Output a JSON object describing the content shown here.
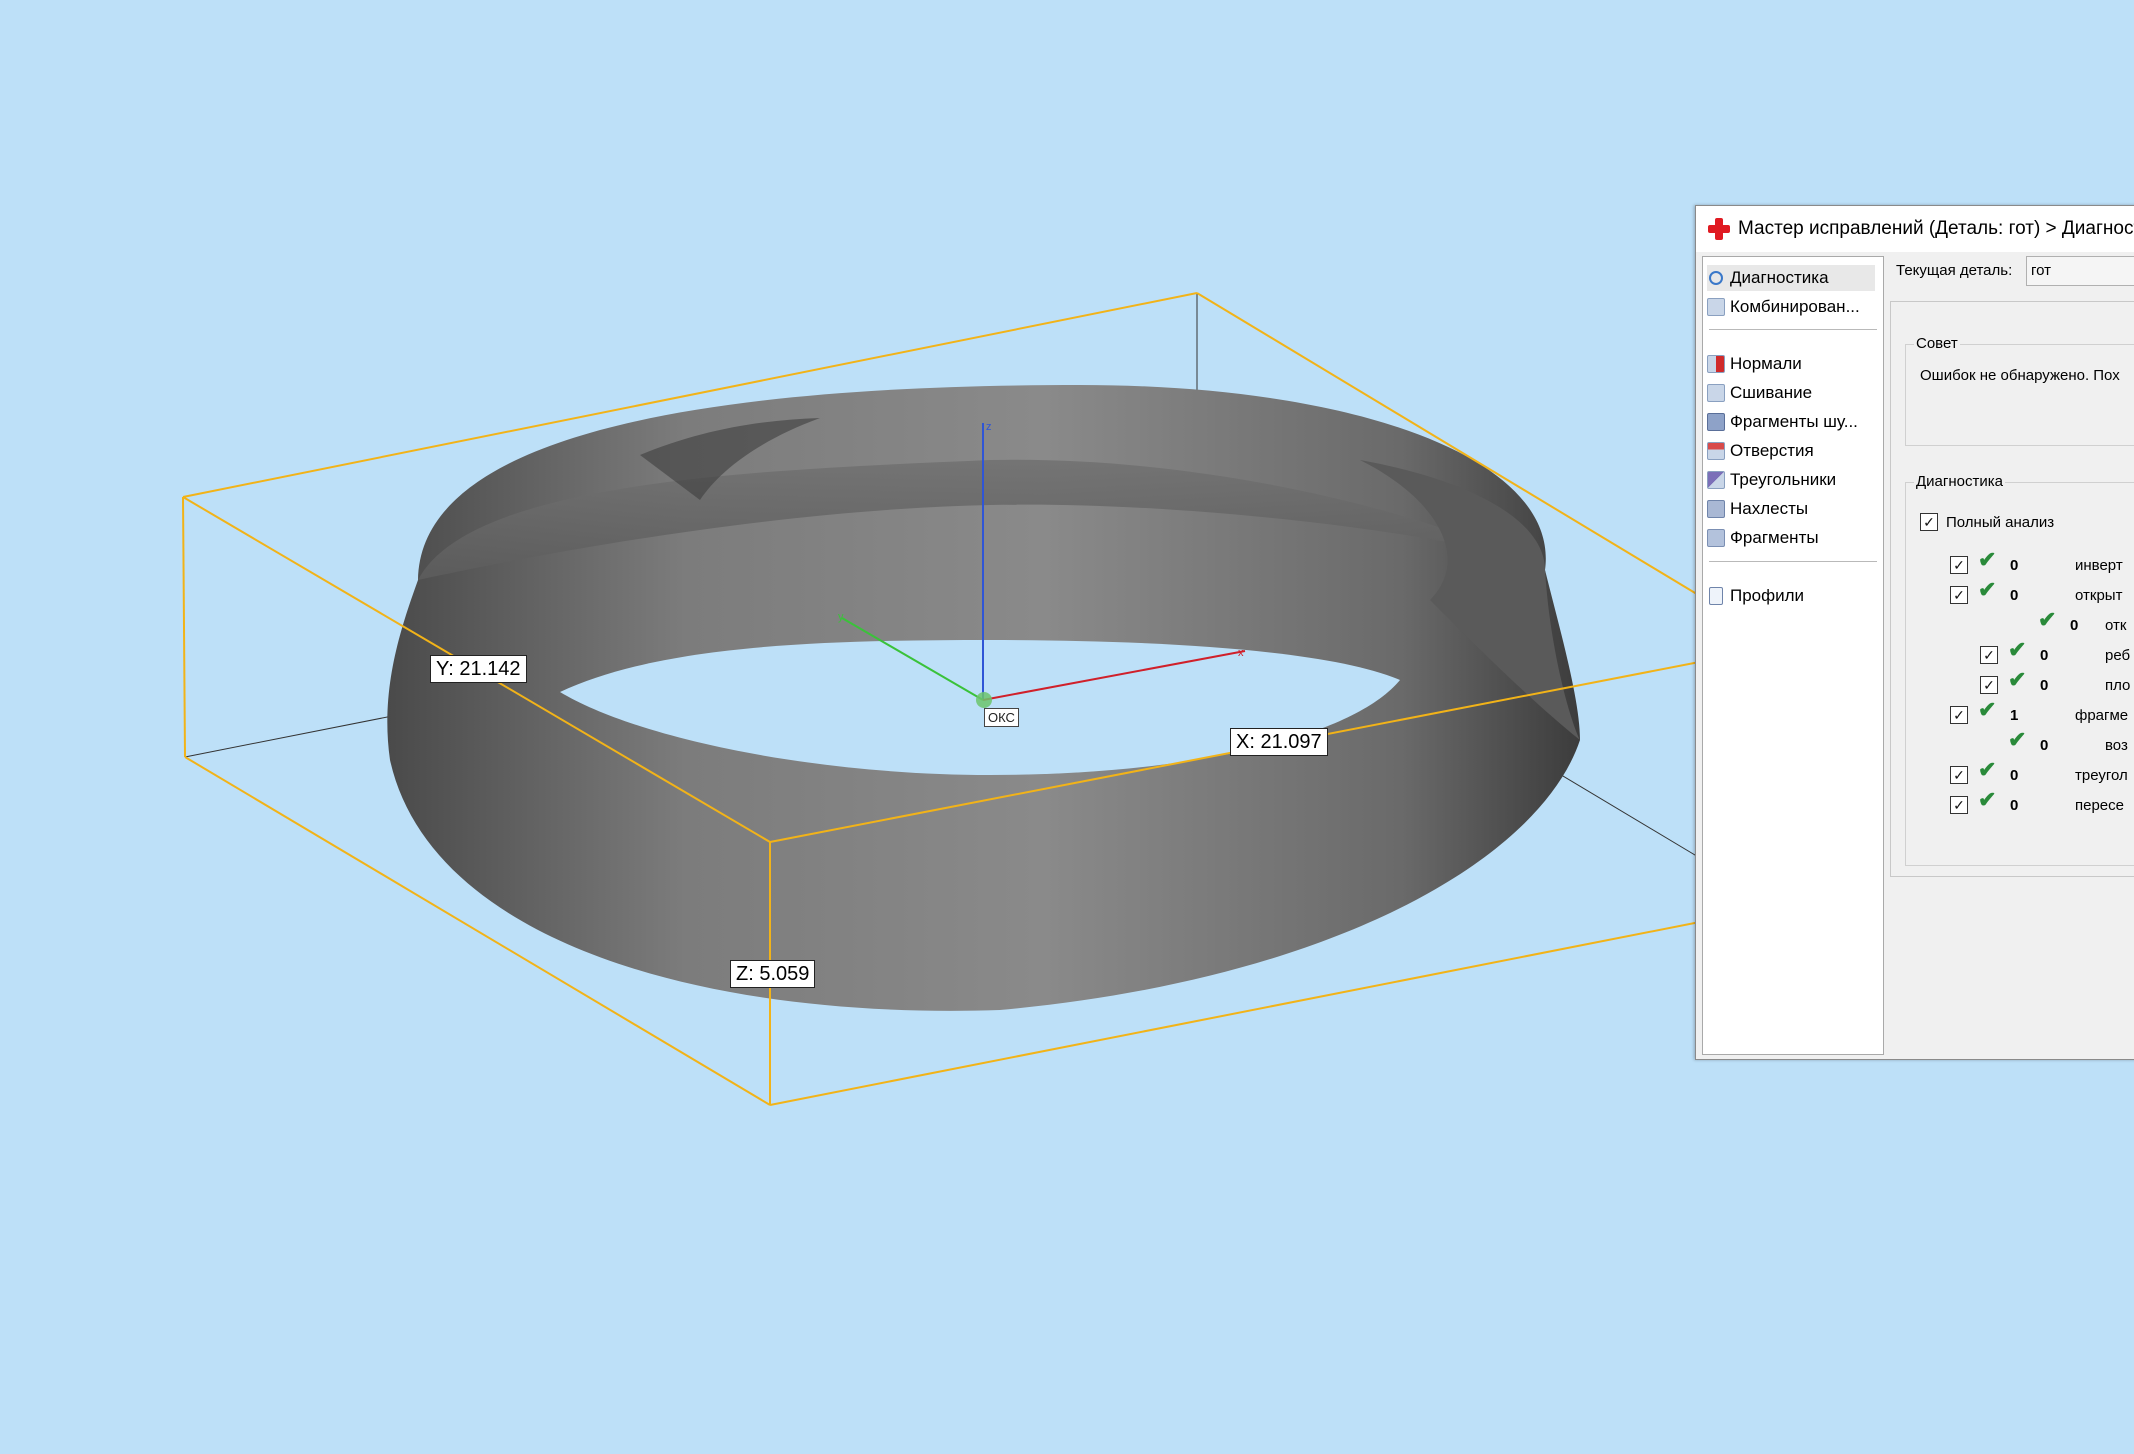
{
  "viewport": {
    "background_color": "#bde0f8",
    "bbox_color": "#f2b318",
    "model_color": "#6b6b6b",
    "dimensions": {
      "x_label": "X: 21.097",
      "y_label": "Y: 21.142",
      "z_label": "Z: 5.059"
    },
    "axes": {
      "origin_label": "ОКС",
      "z_axis_label": "z",
      "y_axis_label": "y",
      "x_axis_label": "x",
      "x_color": "#d0202a",
      "y_color": "#3ac23a",
      "z_color": "#2f55d6"
    }
  },
  "wizard": {
    "title": "Мастер исправлений (Деталь: гот) > Диагностика",
    "nav": {
      "items": [
        {
          "label": "Диагностика",
          "icon": "magnifier-icon"
        },
        {
          "label": "Комбинирован...",
          "icon": "combine-icon"
        },
        {
          "label": "Нормали",
          "icon": "normals-icon"
        },
        {
          "label": "Сшивание",
          "icon": "stitching-icon"
        },
        {
          "label": "Фрагменты шу...",
          "icon": "noise-shells-icon"
        },
        {
          "label": "Отверстия",
          "icon": "holes-icon"
        },
        {
          "label": "Треугольники",
          "icon": "triangles-icon"
        },
        {
          "label": "Нахлесты",
          "icon": "overlaps-icon"
        },
        {
          "label": "Фрагменты",
          "icon": "shells-icon"
        },
        {
          "label": "Профили",
          "icon": "profiles-icon"
        }
      ]
    },
    "current_part_label": "Текущая деталь:",
    "current_part_value": "гот",
    "advice": {
      "title": "Совет",
      "text": "Ошибок не обнаружено. Пох"
    },
    "diagnostics": {
      "title": "Диагностика",
      "full_analysis": "Полный анализ",
      "rows": [
        {
          "count": "0",
          "label": "инверт"
        },
        {
          "count": "0",
          "label": "открыт"
        },
        {
          "count": "0",
          "label": "отк"
        },
        {
          "count": "0",
          "label": "реб"
        },
        {
          "count": "0",
          "label": "пло"
        },
        {
          "count": "1",
          "label": "фрагме"
        },
        {
          "count": "0",
          "label": "воз"
        },
        {
          "count": "0",
          "label": "треугол"
        },
        {
          "count": "0",
          "label": "пересе"
        }
      ]
    }
  }
}
